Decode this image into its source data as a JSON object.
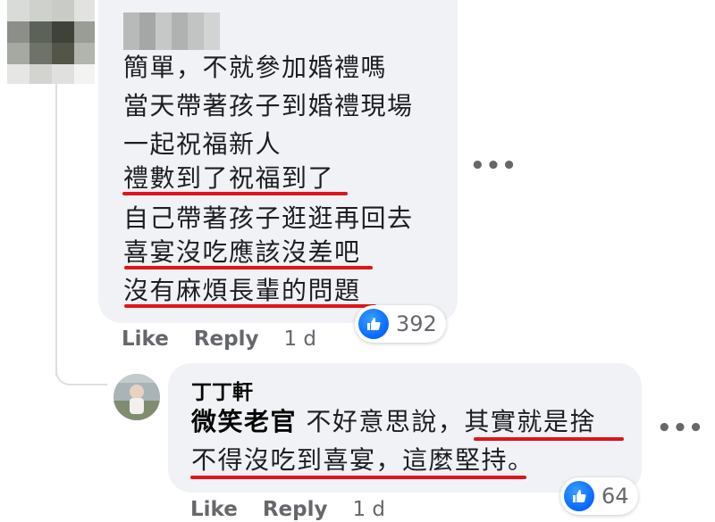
{
  "comment1": {
    "lines": [
      "簡單，不就參加婚禮嗎",
      "當天帶著孩子到婚禮現場",
      "一起祝福新人",
      "禮數到了祝福到了",
      "自己帶著孩子逛逛再回去",
      "喜宴沒吃應該沒差吧",
      "沒有麻煩長輩的問題"
    ],
    "reaction_count": "392",
    "like_label": "Like",
    "reply_label": "Reply",
    "time": "1 d"
  },
  "reply": {
    "author": "丁丁軒",
    "mention": "微笑老官",
    "line1_text": " 不好意思說，其實就是捨",
    "line2_text": "不得沒吃到喜宴，這麼堅持。",
    "reaction_count": "64",
    "like_label": "Like",
    "reply_label": "Reply",
    "time": "1 d"
  },
  "colors": {
    "bubble": "#f0f2f5",
    "underline": "#e0141b",
    "like_blue": "#0866ff",
    "secondary_text": "#65676b"
  },
  "icons": [
    "like-reaction-icon",
    "more-options-icon"
  ]
}
